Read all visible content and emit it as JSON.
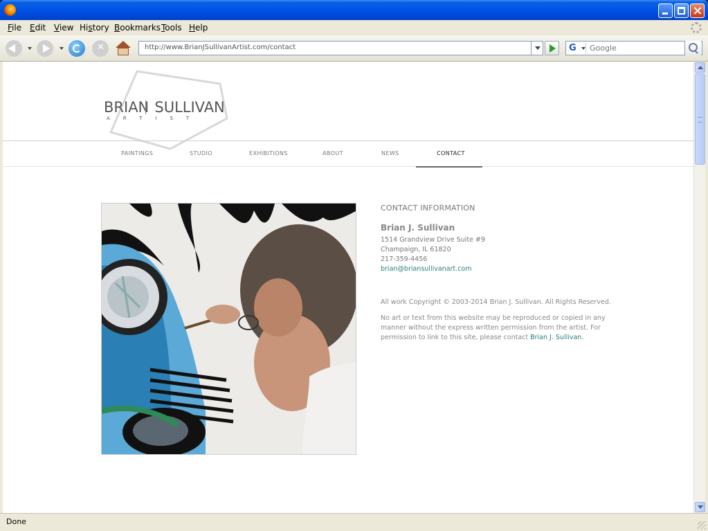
{
  "window": {
    "title": ""
  },
  "menu": {
    "items": [
      {
        "pre": "",
        "key": "F",
        "post": "ile"
      },
      {
        "pre": "",
        "key": "E",
        "post": "dit"
      },
      {
        "pre": "",
        "key": "V",
        "post": "iew"
      },
      {
        "pre": "Hi",
        "key": "s",
        "post": "tory"
      },
      {
        "pre": "",
        "key": "B",
        "post": "ookmarks"
      },
      {
        "pre": "",
        "key": "T",
        "post": "ools"
      },
      {
        "pre": "",
        "key": "H",
        "post": "elp"
      }
    ]
  },
  "navbar": {
    "url": "http://www.BrianJSullivanArtist.com/contact",
    "search_placeholder": "Google",
    "search_engine_icon": "G"
  },
  "site": {
    "logo": {
      "first": "BRIAN",
      "last": "SULLIVAN",
      "sub": "ARTIST"
    },
    "nav": [
      {
        "label": "PAINTINGS",
        "active": false
      },
      {
        "label": "STUDIO",
        "active": false
      },
      {
        "label": "EXHIBITIONS",
        "active": false
      },
      {
        "label": "ABOUT",
        "active": false
      },
      {
        "label": "NEWS",
        "active": false
      },
      {
        "label": "CONTACT",
        "active": true
      }
    ]
  },
  "contact": {
    "heading": "CONTACT INFORMATION",
    "name": "Brian J. Sullivan",
    "address1": "1514 Grandview Drive Suite #9",
    "address2": "Champaign, IL 61820",
    "phone": "217-359-4456",
    "email": "brian@briansullivanart.com",
    "copyright": "All work Copyright © 2003-2014 Brian J. Sullivan. All Rights Reserved.",
    "permission_text": "No art or text from this website may be reproduced or copied in any manner without the express written permission from the artist. For permission to link to this site, please contact",
    "permission_link": "Brian J. Sullivan."
  },
  "status": {
    "text": "Done"
  },
  "colors": {
    "accent_link": "#2a7f80",
    "titlebar": "#0055e5"
  }
}
